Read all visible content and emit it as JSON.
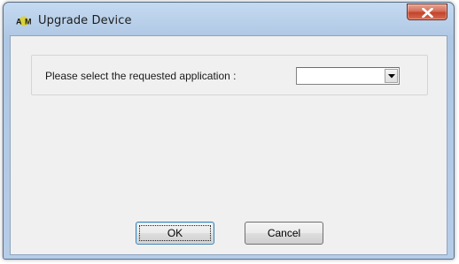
{
  "window": {
    "title": "Upgrade Device",
    "logo_icon": "app-logo-icon",
    "close_icon": "close-icon"
  },
  "form": {
    "prompt_label": "Please select the requested application :",
    "application_select": {
      "value": "",
      "dropdown_icon": "chevron-down-icon"
    }
  },
  "buttons": {
    "ok_label": "OK",
    "cancel_label": "Cancel"
  },
  "colors": {
    "title_bar": "#b8cfe9",
    "close_button": "#c3442a",
    "dialog_body": "#f0f0f0",
    "logo_circle": "#d6cf3a"
  }
}
